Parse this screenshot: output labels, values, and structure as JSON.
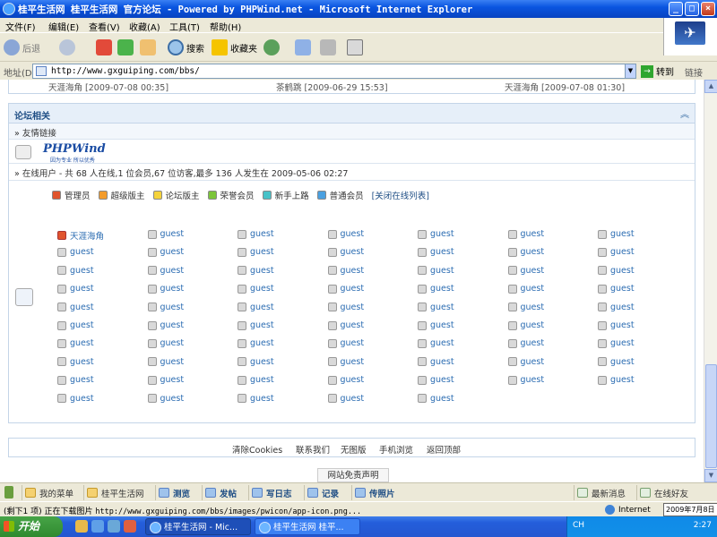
{
  "window": {
    "title": "桂平生活网 桂平生活网 官方论坛 - Powered by PHPWind.net - Microsoft Internet Explorer"
  },
  "menu": [
    "文件(F)",
    "编辑(E)",
    "查看(V)",
    "收藏(A)",
    "工具(T)",
    "帮助(H)"
  ],
  "toolbar": {
    "back": "后退",
    "search": "搜索",
    "favorites": "收藏夹"
  },
  "address": {
    "label": "地址(D)",
    "url": "http://www.gxguiping.com/bbs/",
    "go": "转到",
    "links": "链接"
  },
  "page": {
    "top_row": [
      "天涯海角 [2009-07-08 00:35]",
      "茶鹤跳 [2009-06-29 15:53]",
      "天涯海角 [2009-07-08 01:30]"
    ],
    "forum_section": {
      "title": "论坛相关",
      "friend_links": "» 友情链接",
      "logo_text": "PHPWind",
      "logo_slogan": "因为专业 所以优秀",
      "online_users": "» 在线用户 - 共 68 人在线,1 位会员,67 位访客,最多 136 人发生在 2009-05-06 02:27"
    },
    "legend": [
      {
        "label": "管理员",
        "color": "#e0542d"
      },
      {
        "label": "超级版主",
        "color": "#f39c2c"
      },
      {
        "label": "论坛版主",
        "color": "#f5d33c"
      },
      {
        "label": "荣誉会员",
        "color": "#7cc53a"
      },
      {
        "label": "新手上路",
        "color": "#48c2c8"
      },
      {
        "label": "普通会员",
        "color": "#4aa0e0"
      }
    ],
    "legend_close": "[关闭在线列表]",
    "online_list": [
      [
        "天涯海角",
        "guest",
        "guest",
        "guest",
        "guest",
        "guest",
        "guest"
      ],
      [
        "guest",
        "guest",
        "guest",
        "guest",
        "guest",
        "guest",
        "guest"
      ],
      [
        "guest",
        "guest",
        "guest",
        "guest",
        "guest",
        "guest",
        "guest"
      ],
      [
        "guest",
        "guest",
        "guest",
        "guest",
        "guest",
        "guest",
        "guest"
      ],
      [
        "guest",
        "guest",
        "guest",
        "guest",
        "guest",
        "guest",
        "guest"
      ],
      [
        "guest",
        "guest",
        "guest",
        "guest",
        "guest",
        "guest",
        "guest"
      ],
      [
        "guest",
        "guest",
        "guest",
        "guest",
        "guest",
        "guest",
        "guest"
      ],
      [
        "guest",
        "guest",
        "guest",
        "guest",
        "guest",
        "guest",
        "guest"
      ],
      [
        "guest",
        "guest",
        "guest",
        "guest",
        "guest",
        "guest",
        "guest"
      ],
      [
        "guest",
        "guest",
        "guest",
        "guest",
        "guest"
      ]
    ],
    "footer_links": [
      "清除Cookies",
      "联系我们",
      "无图版",
      "手机浏览",
      "返回顶部"
    ],
    "disclaimer": "网站免责声明"
  },
  "forum_toolbar": {
    "items": [
      "我的菜单",
      "桂平生活网",
      "测览",
      "发帖",
      "写日志",
      "记录",
      "传照片"
    ],
    "right_items": [
      "最新消息",
      "在线好友"
    ]
  },
  "status": {
    "text_prefix": "(剩下1 项) 正在下载图片",
    "text_url": "http://www.gxguiping.com/bbs/images/pwicon/app-icon.png...",
    "zone": "Internet",
    "date": "2009年7月8日"
  },
  "taskbar": {
    "start": "开始",
    "tasks": [
      "桂平生活网 - Mic...",
      "桂平生活网 桂平..."
    ],
    "lang": "CH",
    "time": "2:27"
  }
}
